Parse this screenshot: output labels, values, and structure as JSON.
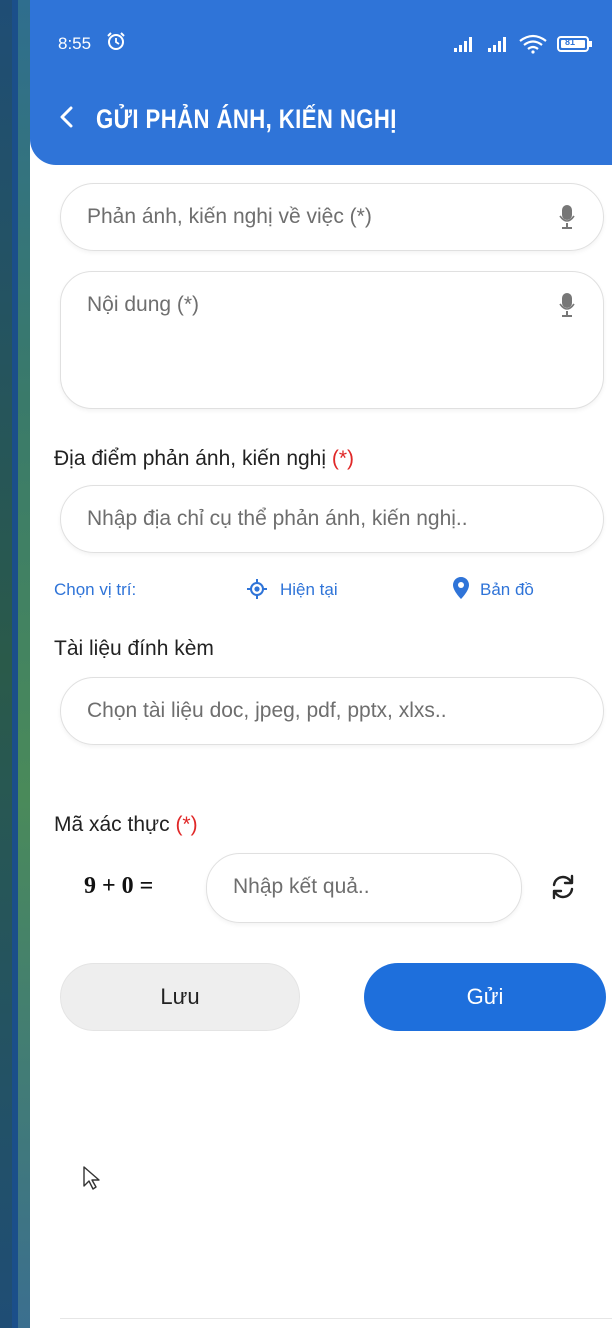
{
  "status_bar": {
    "time": "8:55",
    "battery": "81"
  },
  "header": {
    "title": "GỬI PHẢN ÁNH, KIẾN NGHỊ"
  },
  "form": {
    "subject_placeholder": "Phản ánh, kiến nghị về việc (*)",
    "content_placeholder": "Nội dung (*)",
    "location_label": "Địa điểm phản ánh, kiến nghị",
    "required_mark": "(*)",
    "location_placeholder": "Nhập địa chỉ cụ thể phản ánh, kiến nghị..",
    "choose_location_label": "Chọn vị trí:",
    "current_location_label": "Hiện tại",
    "map_label": "Bản đồ",
    "attachment_label": "Tài liệu đính kèm",
    "attachment_placeholder": "Chọn tài liệu doc, jpeg, pdf, pptx, xlxs..",
    "captcha_label": "Mã xác thực",
    "captcha_equation": "9 + 0 =",
    "captcha_placeholder": "Nhập kết quả.."
  },
  "buttons": {
    "save_label": "Lưu",
    "send_label": "Gửi"
  },
  "colors": {
    "primary": "#2f74d8",
    "send_button": "#1e6fdc",
    "required": "#e02828"
  }
}
